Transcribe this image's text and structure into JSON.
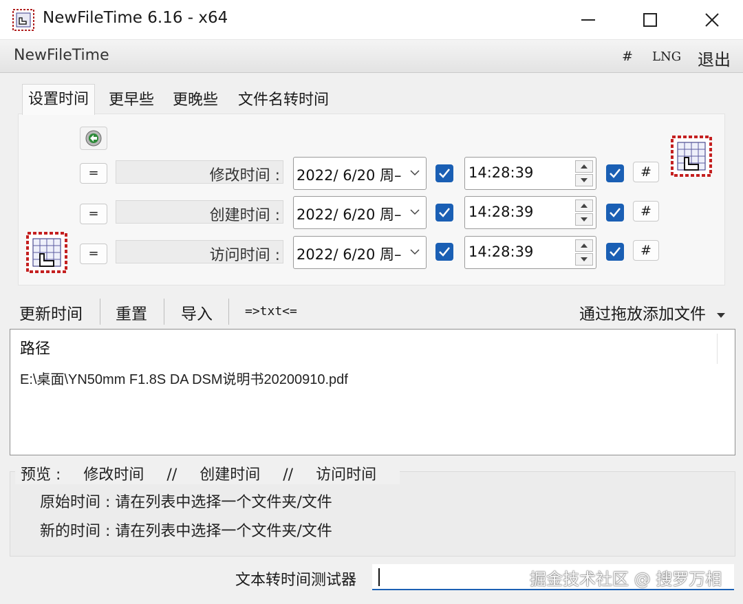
{
  "window": {
    "title": "NewFileTime 6.16 - x64",
    "minimize_icon": "minimize-icon",
    "maximize_icon": "maximize-icon",
    "close_icon": "close-icon"
  },
  "menubar": {
    "app_label": "NewFileTime",
    "hash": "#",
    "lng": "LNG",
    "exit": "退出"
  },
  "tabs": [
    {
      "label": "设置时间",
      "active": true
    },
    {
      "label": "更早些"
    },
    {
      "label": "更晚些"
    },
    {
      "label": "文件名转时间"
    }
  ],
  "panel": {
    "refresh_icon": "refresh-icon",
    "rows": [
      {
        "eq": "=",
        "label": "修改时间 :",
        "date": "2022/  6/20 周–",
        "time": "14:28:39",
        "hash": "#"
      },
      {
        "eq": "=",
        "label": "创建时间 :",
        "date": "2022/  6/20 周–",
        "time": "14:28:39",
        "hash": "#"
      },
      {
        "eq": "=",
        "label": "访问时间 :",
        "date": "2022/  6/20 周–",
        "time": "14:28:39",
        "hash": "#"
      }
    ]
  },
  "toolbar": {
    "update": "更新时间",
    "reset": "重置",
    "import": "导入",
    "txt": "=>txt<=",
    "add_files": "通过拖放添加文件"
  },
  "file_list": {
    "header": "路径",
    "rows": [
      "E:\\桌面\\YN50mm F1.8S DA DSM说明书20200910.pdf"
    ]
  },
  "preview": {
    "legend": [
      "预览 :",
      "修改时间",
      "//",
      "创建时间",
      "//",
      "访问时间"
    ],
    "original": "原始时间 : 请在列表中选择一个文件夹/文件",
    "new": "新的时间 : 请在列表中选择一个文件夹/文件"
  },
  "tester": {
    "label": "文本转时间测试器",
    "value": ""
  },
  "watermark": "掘金技术社区 @ 搜罗万相",
  "colors": {
    "accent": "#1a5fb4",
    "window_bg": "#f0f0f0"
  }
}
